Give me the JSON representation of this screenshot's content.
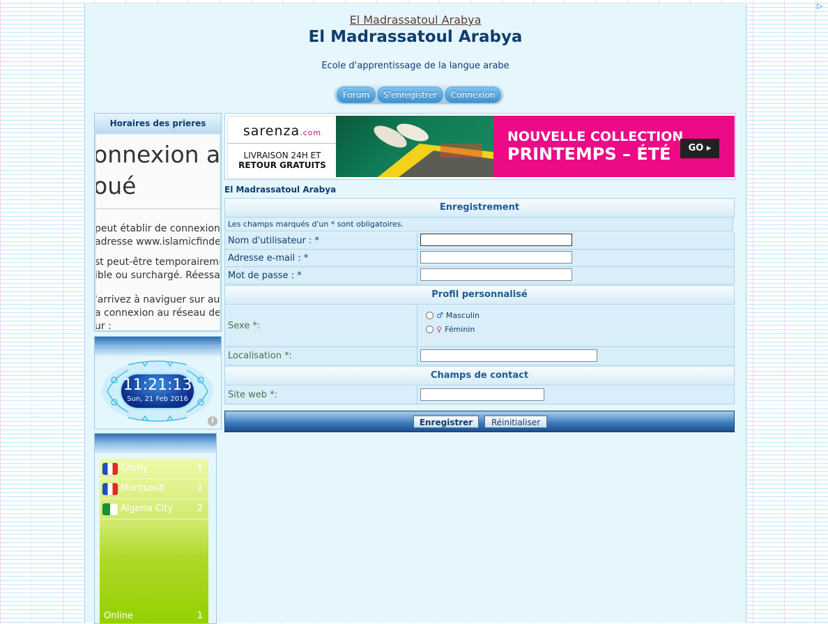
{
  "header": {
    "site_link": "El Madrassatoul Arabya",
    "site_title": "El Madrassatoul Arabya",
    "site_description": "Ecole d'apprentissage de la langue arabe"
  },
  "nav": {
    "items": [
      "Forum",
      "S'enregistrer",
      "Connexion"
    ]
  },
  "sidebar": {
    "prayer": {
      "title": "Horaires des prieres",
      "error_heading_line1": "onnexion a",
      "error_heading_line2": "oué",
      "error_p1_line1": "peut établir de connexion",
      "error_p1_line2": "adresse www.islamicfinde",
      "error_p2_line1": "st peut-être temporaireme",
      "error_p2_line2": "ible ou surchargé. Réessay",
      "error_p3_line1": "'arrivez à naviguer sur auc",
      "error_p3_line2": "a connexion au réseau de",
      "error_p3_line3": "ur :"
    },
    "clock": {
      "time": "11:21:13",
      "date": "Sun, 21 Feb 2016",
      "info_glyph": "i"
    },
    "cities": {
      "items": [
        {
          "name": "Clichy",
          "count": "1",
          "flag": "france"
        },
        {
          "name": "Montsoult",
          "count": "1",
          "flag": "france"
        },
        {
          "name": "Algeria City",
          "count": "2",
          "flag": "algeria"
        }
      ],
      "online_label": "Online",
      "online_count": "1"
    }
  },
  "ad": {
    "brand": "sarenza",
    "brand_suffix": ".com",
    "tagline_line1": "LIVRAISON 24H ET",
    "tagline_line2": "RETOUR GRATUITS",
    "headline_line1": "NOUVELLE COLLECTION",
    "headline_line2": "PRINTEMPS – ÉTÉ",
    "cta": "GO ▸",
    "colors": {
      "pink": "#ec0a86",
      "green": "#0f7a55"
    }
  },
  "breadcrumb": "El Madrassatoul Arabya",
  "form": {
    "section_registration": "Enregistrement",
    "required_note": "Les champs marqués d'un * sont obligatoires.",
    "username_label": "Nom d'utilisateur : *",
    "email_label": "Adresse e-mail : *",
    "password_label": "Mot de passe : *",
    "section_profile": "Profil personnalisé",
    "sex_label": "Sexe *:",
    "sex_options": [
      "Masculin",
      "Féminin"
    ],
    "location_label": "Localisation *:",
    "section_contact": "Champs de contact",
    "website_label": "Site web *:",
    "submit_label": "Enregistrer",
    "reset_label": "Réinitialiser"
  }
}
